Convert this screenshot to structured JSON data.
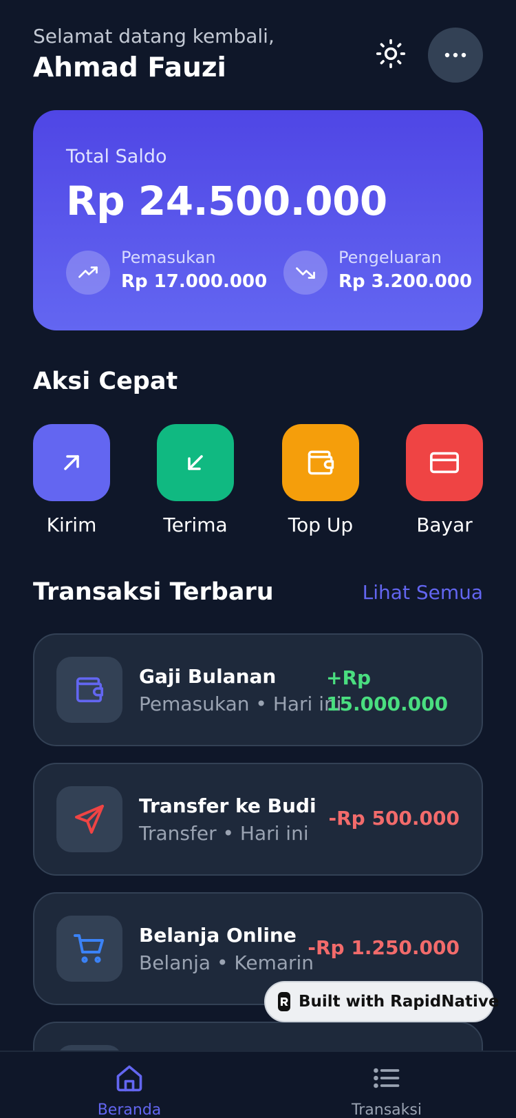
{
  "header": {
    "greeting": "Selamat datang kembali,",
    "username": "Ahmad Fauzi",
    "theme_icon": "sun-icon",
    "more_icon": "more-horizontal-icon"
  },
  "balance": {
    "label": "Total Saldo",
    "amount": "Rp 24.500.000",
    "income_label": "Pemasukan",
    "income_value": "Rp 17.000.000",
    "expense_label": "Pengeluaran",
    "expense_value": "Rp 3.200.000"
  },
  "quick_actions": {
    "title": "Aksi Cepat",
    "items": [
      {
        "label": "Kirim",
        "icon": "arrow-up-right-icon",
        "color": "#6366f1"
      },
      {
        "label": "Terima",
        "icon": "arrow-down-left-icon",
        "color": "#10b981"
      },
      {
        "label": "Top Up",
        "icon": "wallet-icon",
        "color": "#f59e0b"
      },
      {
        "label": "Bayar",
        "icon": "credit-card-icon",
        "color": "#ef4444"
      }
    ]
  },
  "transactions": {
    "title": "Transaksi Terbaru",
    "see_all": "Lihat Semua",
    "items": [
      {
        "name": "Gaji Bulanan",
        "meta": "Pemasukan • Hari ini",
        "amount": "+Rp 15.000.000",
        "type": "income",
        "icon": "wallet-icon"
      },
      {
        "name": "Transfer ke Budi",
        "meta": "Transfer • Hari ini",
        "amount": "-Rp 500.000",
        "type": "expense",
        "icon": "send-icon"
      },
      {
        "name": "Belanja Online",
        "meta": "Belanja • Kemarin",
        "amount": "-Rp 1.250.000",
        "type": "expense",
        "icon": "shopping-cart-icon"
      }
    ]
  },
  "badge": {
    "text": "Built with RapidNative"
  },
  "nav": {
    "home_label": "Beranda",
    "transactions_label": "Transaksi"
  },
  "colors": {
    "background": "#0f1729",
    "card": "#1e293b",
    "accent": "#6366f1",
    "income": "#4ade80",
    "expense": "#f26b6b"
  }
}
